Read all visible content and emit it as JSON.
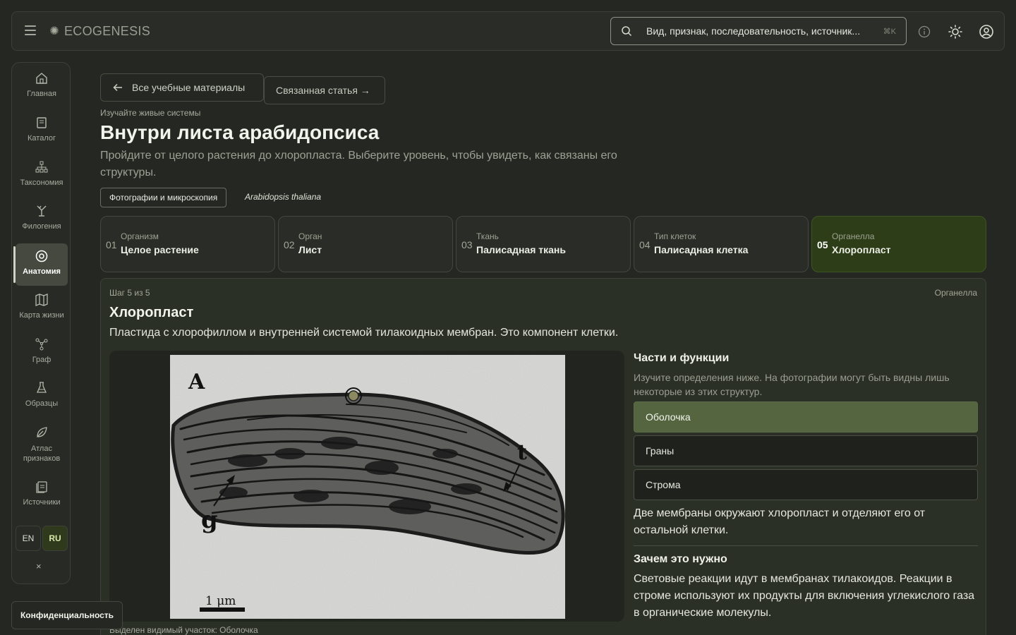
{
  "app": {
    "name": "ECOGENESIS"
  },
  "search": {
    "placeholder": "Вид, признак, последовательность, источник...",
    "shortcut": "⌘K"
  },
  "sidebar": {
    "items": [
      {
        "label": "Главная",
        "icon": "home-icon"
      },
      {
        "label": "Каталог",
        "icon": "book-icon"
      },
      {
        "label": "Таксономия",
        "icon": "hierarchy-icon"
      },
      {
        "label": "Филогения",
        "icon": "tree-icon"
      },
      {
        "label": "Анатомия",
        "icon": "cell-icon"
      },
      {
        "label": "Карта жизни",
        "icon": "map-icon"
      },
      {
        "label": "Граф",
        "icon": "graph-icon"
      },
      {
        "label": "Образцы",
        "icon": "flask-icon"
      },
      {
        "label": "Атлас признаков",
        "icon": "leaf-icon"
      },
      {
        "label": "Источники",
        "icon": "sources-icon"
      }
    ],
    "languages": [
      "EN",
      "RU"
    ],
    "close": "×"
  },
  "privacy": "Конфиденциальность",
  "header": {
    "back_label": "Все учебные материалы",
    "related_label": "Связанная статья →",
    "eyebrow": "Изучайте живые системы",
    "title": "Внутри листа арабидопсиса",
    "subtitle": "Пройдите от целого растения до хлоропласта. Выберите уровень, чтобы увидеть, как связаны его структуры.",
    "tag": "Фотографии и микроскопия",
    "species": "Arabidopsis thaliana"
  },
  "steps": [
    {
      "num": "01",
      "kind": "Организм",
      "name": "Целое растение"
    },
    {
      "num": "02",
      "kind": "Орган",
      "name": "Лист"
    },
    {
      "num": "03",
      "kind": "Ткань",
      "name": "Палисадная ткань"
    },
    {
      "num": "04",
      "kind": "Тип клеток",
      "name": "Палисадная клетка"
    },
    {
      "num": "05",
      "kind": "Органелла",
      "name": "Хлоропласт"
    }
  ],
  "detail": {
    "step": "Шаг 5 из 5",
    "kind": "Органелла",
    "title": "Хлоропласт",
    "description": "Пластида с хлорофиллом и внутренней системой тилакоидных мембран. Это компонент клетки.",
    "photo_labels": {
      "panel": "A",
      "t": "t",
      "g": "g",
      "scale": "1 μm"
    },
    "caption": "Выделен видимый участок: Оболочка",
    "parts_title": "Части и функции",
    "parts_hint": "Изучите определения ниже. На фотографии могут быть видны лишь некоторые из этих структур.",
    "parts": [
      "Оболочка",
      "Граны",
      "Строма"
    ],
    "selected_part": "Оболочка",
    "part_description": "Две мембраны окружают хлоропласт и отделяют его от остальной клетки.",
    "why_title": "Зачем это нужно",
    "why_body": "Световые реакции идут в мембранах тилакоидов. Реакции в строме используют их продукты для включения углекислого газа в органические молекулы."
  },
  "colors": {
    "accent_active_step": "#2d3d17",
    "selected_part": "#546540",
    "background": "#252722"
  }
}
